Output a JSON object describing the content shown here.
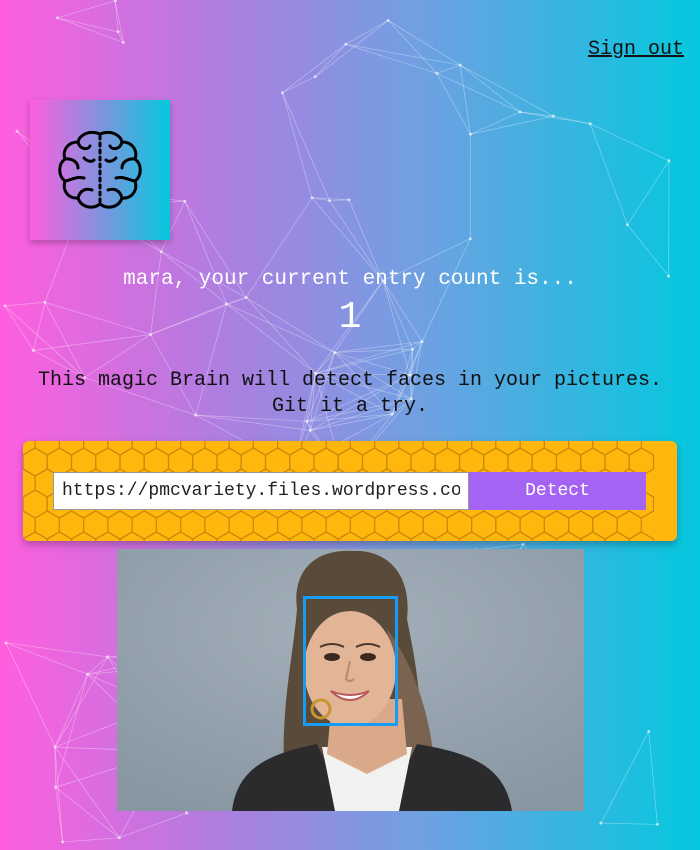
{
  "nav": {
    "sign_out_label": "Sign out"
  },
  "logo": {
    "icon": "brain-icon"
  },
  "rank": {
    "message": "mara, your current entry count is...",
    "count": "1"
  },
  "intro": {
    "line1": "This magic Brain will detect faces in your pictures.",
    "line2": "Git it a try."
  },
  "form": {
    "url_value": "https://pmcvariety.files.wordpress.com",
    "button_label": "Detect"
  },
  "result": {
    "image_alt": "photo of a smiling woman",
    "face_box_color": "#149df2"
  },
  "colors": {
    "gradient_left": "#ff5edf",
    "gradient_right": "#04c8de",
    "button": "#a463f2",
    "form_background": "#ffb60d"
  }
}
